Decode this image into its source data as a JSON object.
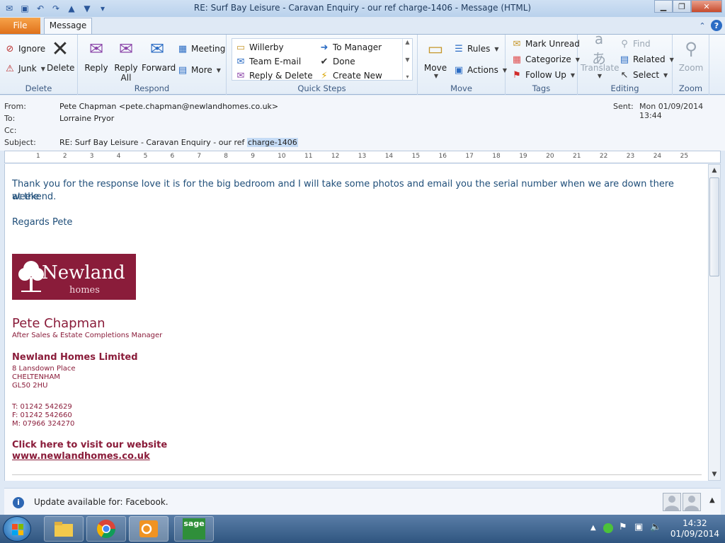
{
  "window": {
    "title": "RE: Surf Bay Leisure - Caravan Enquiry  - our ref charge-1406  -  Message (HTML)"
  },
  "tabs": {
    "file": "File",
    "message": "Message"
  },
  "ribbon": {
    "delete_group": {
      "label": "Delete",
      "ignore": "Ignore",
      "junk": "Junk",
      "delete": "Delete"
    },
    "respond_group": {
      "label": "Respond",
      "reply": "Reply",
      "reply_all_1": "Reply",
      "reply_all_2": "All",
      "forward": "Forward",
      "meeting": "Meeting",
      "more": "More"
    },
    "quicksteps_group": {
      "label": "Quick Steps",
      "items": [
        "Willerby",
        "To Manager",
        "Team E-mail",
        "Done",
        "Reply & Delete",
        "Create New"
      ]
    },
    "move_group": {
      "label": "Move",
      "move": "Move",
      "rules": "Rules",
      "actions": "Actions"
    },
    "tags_group": {
      "label": "Tags",
      "mark_unread": "Mark Unread",
      "categorize": "Categorize",
      "follow_up": "Follow Up"
    },
    "editing_group": {
      "label": "Editing",
      "translate": "Translate",
      "find": "Find",
      "related": "Related",
      "select": "Select"
    },
    "zoom_group": {
      "label": "Zoom",
      "zoom": "Zoom"
    }
  },
  "header": {
    "from_label": "From:",
    "from_value": "Pete Chapman <pete.chapman@newlandhomes.co.uk>",
    "to_label": "To:",
    "to_value": "Lorraine Pryor",
    "cc_label": "Cc:",
    "subject_label": "Subject:",
    "subject_value": "RE: Surf Bay Leisure - Caravan Enquiry  - our ref ",
    "subject_highlight": "charge-1406",
    "sent_label": "Sent:",
    "sent_value": "Mon 01/09/2014 13:44"
  },
  "ruler": {
    "ticks": [
      "1",
      "2",
      "3",
      "4",
      "5",
      "6",
      "7",
      "8",
      "9",
      "10",
      "11",
      "12",
      "13",
      "14",
      "15",
      "16",
      "17",
      "18",
      "19",
      "20",
      "21",
      "22",
      "23",
      "24",
      "25"
    ]
  },
  "body": {
    "line1": "Thank you for the response love it is for the big bedroom and I will take some photos and email you the serial number when we are down there at the",
    "line2": "weekend.",
    "regards": "Regards Pete"
  },
  "signature": {
    "logo_name": "Newland",
    "logo_sub": "homes",
    "name": "Pete Chapman",
    "title": "After Sales & Estate Completions Manager",
    "company": "Newland Homes Limited",
    "address1": "8 Lansdown Place",
    "address2": "CHELTENHAM",
    "address3": "GL50 2HU",
    "tel": "T:  01242 542629",
    "fax": "F:  01242 542660",
    "mobile": "M:  07966 324270",
    "website_label": "Click here to visit our website",
    "website_link": "www.newlandhomes.co.uk"
  },
  "notification": {
    "text": "Update available for: Facebook."
  },
  "taskbar": {
    "time": "14:32",
    "date": "01/09/2014",
    "sage": "sage"
  },
  "colors": {
    "brand": "#8a1c3a",
    "body_text": "#1f4e79",
    "file_tab": "#e0711a"
  }
}
